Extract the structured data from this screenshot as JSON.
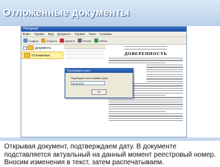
{
  "slide_title": "Отложенные документы",
  "app": {
    "window_title": "Нотариат",
    "menu": [
      "Файл",
      "Правка",
      "Вид",
      "Документ",
      "Сервис",
      "Окно",
      "Справка"
    ],
    "toolbar": [
      {
        "label": "Создать",
        "icon": "new-doc-icon",
        "color": "#5a8fd0"
      },
      {
        "label": "Открыть",
        "icon": "open-doc-icon",
        "color": "#e0a020"
      },
      {
        "label": "Удалить",
        "icon": "delete-icon",
        "color": "#c03030"
      },
      {
        "label": "Печать",
        "icon": "print-icon",
        "color": "#707070"
      },
      {
        "label": "Найти",
        "icon": "search-icon",
        "color": "#3a9a3a"
      }
    ],
    "tree": {
      "root": "Документы",
      "selected": "Отложенные"
    },
    "document": {
      "heading": "ДОВЕРЕННОСТЬ"
    },
    "dialog": {
      "title": "Подтверждение даты",
      "prompt": "Подтвердите или исправьте дату",
      "date_value": "02.04.2012",
      "ok_label": "OK"
    }
  },
  "caption": {
    "line1": "Открывая документ, подтверждаем дату. В документе",
    "line2": "подставляется актуальный на данный момент реестровый номер.",
    "line3": "Вносим изменения в текст, затем распечатываем."
  }
}
